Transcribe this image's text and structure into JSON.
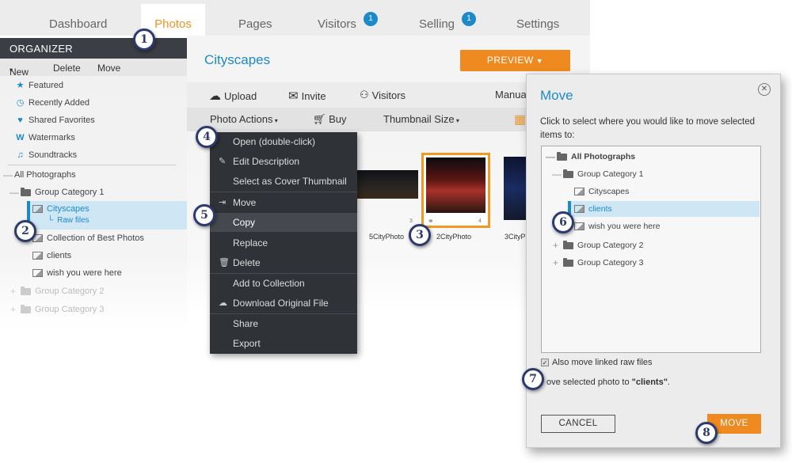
{
  "nav": {
    "tabs": [
      {
        "label": "Dashboard"
      },
      {
        "label": "Photos"
      },
      {
        "label": "Pages"
      },
      {
        "label": "Visitors",
        "badge": "1"
      },
      {
        "label": "Selling",
        "badge": "1"
      },
      {
        "label": "Settings"
      }
    ],
    "active_tab": "Photos",
    "accent": "#f2921e"
  },
  "organizer": {
    "title": "ORGANIZER",
    "toolbar": {
      "new": "New",
      "delete": "Delete",
      "move": "Move"
    },
    "quick_links": [
      {
        "label": "Featured",
        "icon": "star-icon"
      },
      {
        "label": "Recently Added",
        "icon": "clock-icon"
      },
      {
        "label": "Shared Favorites",
        "icon": "heart-icon"
      },
      {
        "label": "Watermarks",
        "icon": "watermark-icon"
      },
      {
        "label": "Soundtracks",
        "icon": "music-note-icon"
      }
    ],
    "tree": {
      "root": "All Photographs",
      "group1": "Group Category 1",
      "selected": "Cityscapes",
      "selected_sub": "Raw files",
      "items": [
        "Collection of Best Photos",
        "clients",
        "wish you were here"
      ],
      "group2": "Group Category 2",
      "group3": "Group Category 3"
    }
  },
  "main": {
    "album_title": "Cityscapes",
    "preview_label": "PREVIEW",
    "toolbar1": {
      "upload": "Upload",
      "invite": "Invite",
      "visitors": "Visitors",
      "manual": "Manua"
    },
    "toolbar2": {
      "photo_actions": "Photo Actions",
      "buy": "Buy",
      "thumbnail_size": "Thumbnail Size"
    },
    "photos": [
      {
        "label": "5CityPhoto",
        "num": "3"
      },
      {
        "label": "2CityPhoto",
        "num": "4"
      },
      {
        "label": "3CityP",
        "num": ""
      }
    ]
  },
  "context_menu": {
    "items": [
      {
        "label": "Open (double-click)"
      },
      {
        "label": "Edit Description",
        "icon": "pencil-icon"
      },
      {
        "label": "Select as Cover Thumbnail"
      },
      {
        "label": "Move",
        "icon": "move-icon"
      },
      {
        "label": "Copy"
      },
      {
        "label": "Replace"
      },
      {
        "label": "Delete",
        "icon": "trash-icon"
      },
      {
        "label": "Add to Collection"
      },
      {
        "label": "Download Original File",
        "icon": "cloud-download-icon"
      },
      {
        "label": "Share"
      },
      {
        "label": "Export"
      }
    ],
    "highlighted": "Copy"
  },
  "dialog": {
    "title": "Move",
    "instruction": "Click to select where you would like to move selected items to:",
    "tree": {
      "root": "All Photographs",
      "group1": "Group Category 1",
      "cityscapes": "Cityscapes",
      "selected": "clients",
      "wish": "wish you were here",
      "group2": "Group Category 2",
      "group3": "Group Category 3"
    },
    "checkbox_label": "Also move linked raw files",
    "checkbox_checked": true,
    "note_prefix": "ove selected photo to ",
    "note_target": "\"clients\"",
    "note_suffix": ".",
    "cancel_label": "CANCEL",
    "move_label": "MOVE"
  },
  "callouts": [
    "1",
    "2",
    "3",
    "4",
    "5",
    "6",
    "7",
    "8"
  ]
}
